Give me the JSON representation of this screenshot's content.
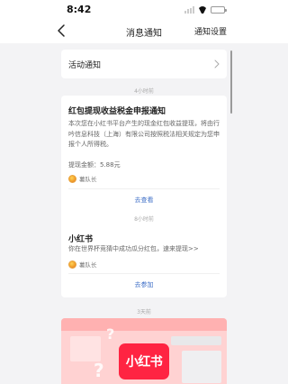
{
  "status": {
    "time": "8:42"
  },
  "nav": {
    "title": "消息通知",
    "right_label": "通知设置"
  },
  "activity": {
    "label": "活动通知"
  },
  "messages": [
    {
      "time": "4小时前",
      "title": "红包提现收益税金申报通知",
      "body": "本次您在小红书平台产生的现金红包收益提现，将由行吟信息科技（上海）有限公司按照税法相关规定为您申报个人所得税。",
      "amount": "提现金额：5.88元",
      "sender": "薯队长",
      "link": "去查看"
    },
    {
      "time": "8小时前",
      "title": "小红书",
      "body": "你在世界杯竞猜中成功瓜分红包，速来提现>>",
      "sender": "薯队长",
      "link": "去参加"
    }
  ],
  "promo": {
    "time": "3天前",
    "logo_text": "小红书"
  },
  "colors": {
    "accent": "#3f6fc7",
    "brand": "#ff2442",
    "background": "#f3f3f5"
  }
}
